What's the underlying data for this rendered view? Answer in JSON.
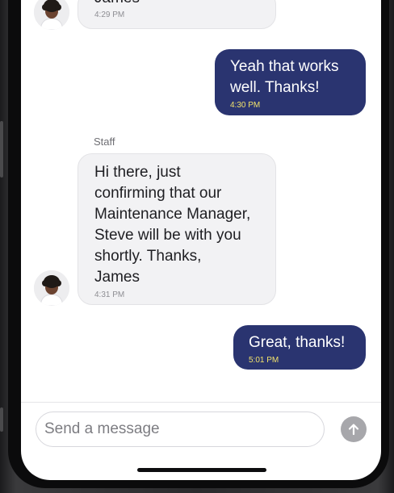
{
  "messages": [
    {
      "direction": "incoming",
      "text": "James",
      "time": "4:29 PM"
    },
    {
      "direction": "outgoing",
      "text": "Yeah that works\nwell. Thanks!",
      "time": "4:30 PM"
    },
    {
      "direction": "incoming",
      "sender": "Staff",
      "text": "Hi there, just\nconfirming that our\nMaintenance Manager,\nSteve will be with you\nshortly.  Thanks,\nJames",
      "time": "4:31 PM"
    },
    {
      "direction": "outgoing",
      "text": "Great, thanks!",
      "time": "5:01 PM"
    }
  ],
  "composer": {
    "placeholder": "Send a message",
    "send_icon": "arrow-up-icon"
  },
  "colors": {
    "outgoing_bubble": "#2a3470",
    "incoming_bubble": "#f2f2f4",
    "outgoing_time": "#f2e36b",
    "send_button": "#a7a7ab"
  }
}
